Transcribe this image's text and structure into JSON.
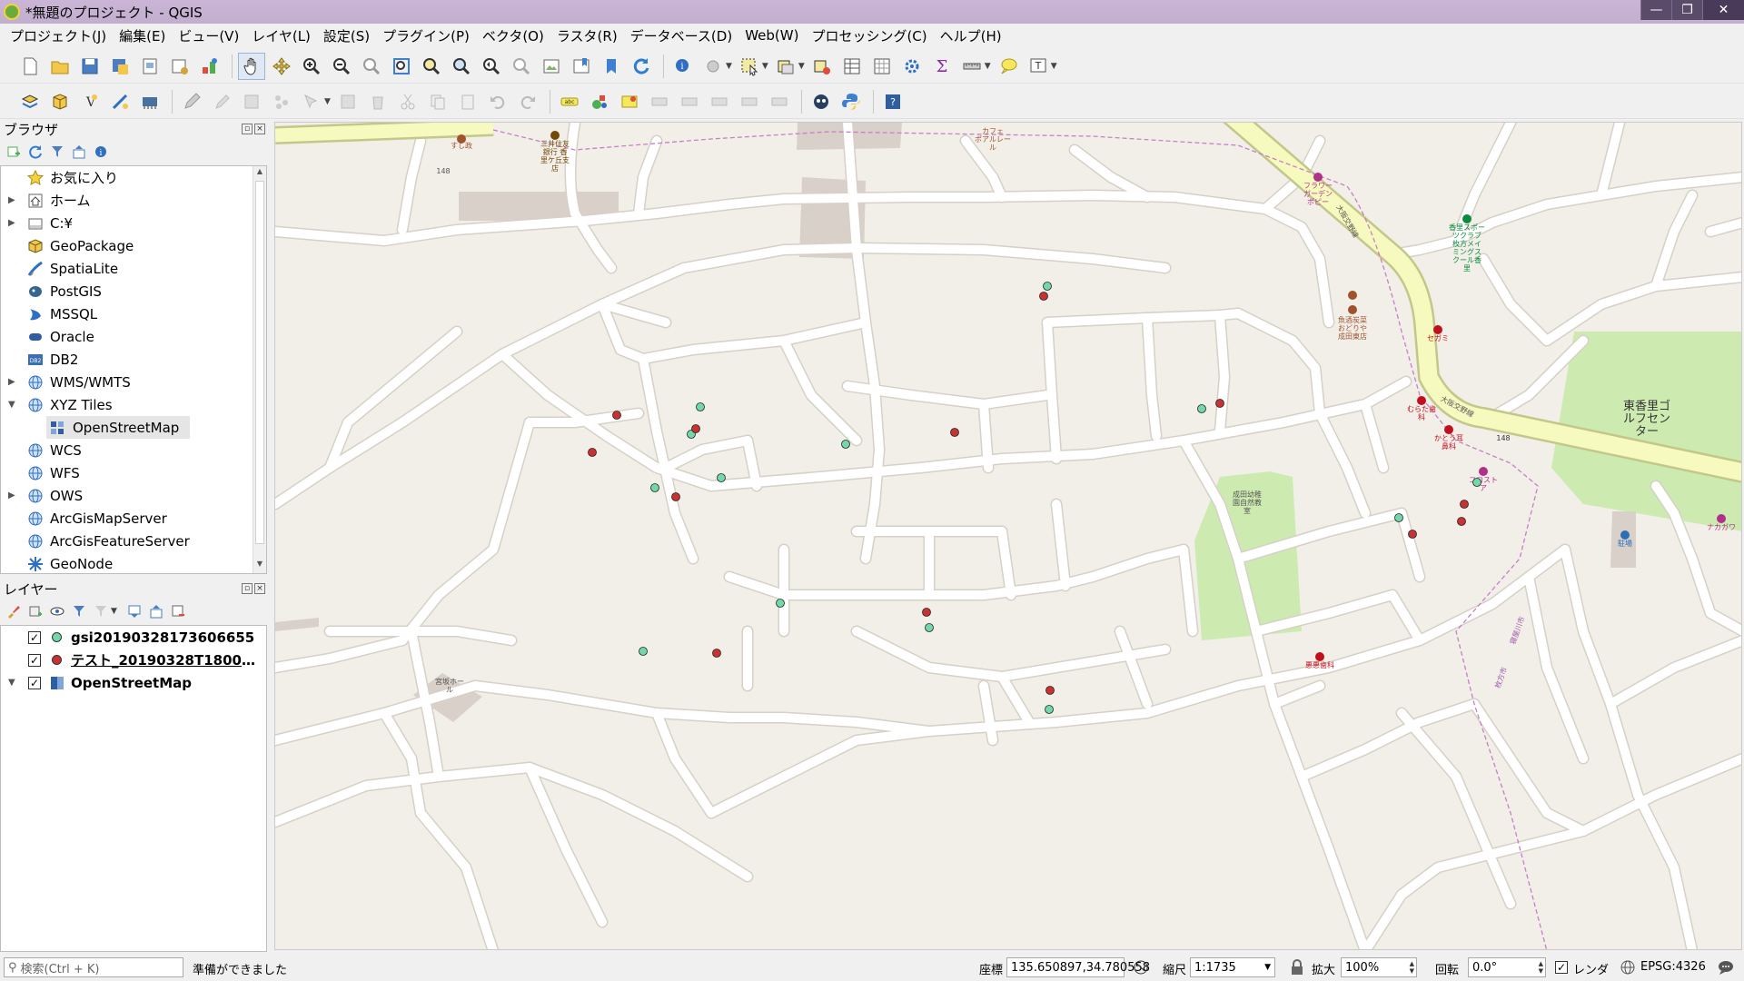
{
  "window": {
    "title": "*無題のプロジェクト - QGIS",
    "buttons": [
      "—",
      "❐",
      "✕"
    ]
  },
  "menu": [
    "プロジェクト(J)",
    "編集(E)",
    "ビュー(V)",
    "レイヤ(L)",
    "設定(S)",
    "プラグイン(P)",
    "ベクタ(O)",
    "ラスタ(R)",
    "データベース(D)",
    "Web(W)",
    "プロセッシング(C)",
    "ヘルプ(H)"
  ],
  "browser": {
    "title": "ブラウザ",
    "items": [
      {
        "label": "お気に入り",
        "icon": "star-icon",
        "expand": ""
      },
      {
        "label": "ホーム",
        "icon": "home-icon",
        "expand": "▶"
      },
      {
        "label": "C:¥",
        "icon": "drive-icon",
        "expand": "▶"
      },
      {
        "label": "GeoPackage",
        "icon": "geopackage-icon",
        "expand": ""
      },
      {
        "label": "SpatiaLite",
        "icon": "spatialite-icon",
        "expand": ""
      },
      {
        "label": "PostGIS",
        "icon": "postgis-icon",
        "expand": ""
      },
      {
        "label": "MSSQL",
        "icon": "mssql-icon",
        "expand": ""
      },
      {
        "label": "Oracle",
        "icon": "oracle-icon",
        "expand": ""
      },
      {
        "label": "DB2",
        "icon": "db2-icon",
        "expand": ""
      },
      {
        "label": "WMS/WMTS",
        "icon": "globe-icon",
        "expand": "▶"
      },
      {
        "label": "XYZ Tiles",
        "icon": "globe-icon",
        "expand": "▼"
      },
      {
        "label": "OpenStreetMap",
        "icon": "xyz-tile-icon",
        "expand": "",
        "child": true,
        "selected": true
      },
      {
        "label": "WCS",
        "icon": "globe-icon",
        "expand": ""
      },
      {
        "label": "WFS",
        "icon": "globe-icon",
        "expand": ""
      },
      {
        "label": "OWS",
        "icon": "globe-icon",
        "expand": "▶"
      },
      {
        "label": "ArcGisMapServer",
        "icon": "globe-icon",
        "expand": ""
      },
      {
        "label": "ArcGisFeatureServer",
        "icon": "globe-icon",
        "expand": ""
      },
      {
        "label": "GeoNode",
        "icon": "geonode-icon",
        "expand": ""
      }
    ]
  },
  "layers": {
    "title": "レイヤー",
    "items": [
      {
        "label": "gsi20190328173606655",
        "color": "#72d8a8",
        "checked": "✓"
      },
      {
        "label": "テスト_20190328T18004…",
        "color": "#c83232",
        "checked": "✓",
        "underline": true
      },
      {
        "label": "OpenStreetMap",
        "color": "",
        "checked": "✓",
        "expand": "▼"
      }
    ]
  },
  "map": {
    "labels": {
      "sushi": "すし政",
      "bank": "三井住友\n銀行 香\n里ケ丘支\n店",
      "route148a": "148",
      "route148b": "148",
      "cafe": "カフェ\nポアルレー\nル",
      "flower": "フラワー\nガーデン\nポピー",
      "road_name1": "大阪交野線",
      "road_name2": "大阪交野線",
      "sports": "香里スポー\nツクラブ\n枚方メイ\nミングス\nクール香\n里",
      "izakaya": "魚酒炭菜\nおどりや\n成田東店",
      "segami": "セガミ",
      "golf": "東香里ゴ\nルフセン\nター",
      "murata": "むらた歯\n科",
      "kato": "かとう耳\n鼻科",
      "kokostore": "ココスト\nア",
      "kindergarten": "成田幼稚\n園自然教\n室",
      "miyanosaka": "宮坂ホー\nル",
      "nakagawa": "ナカガワ",
      "clinic": "悪悪歯科",
      "parking": "駐場",
      "pref": "寝屋川市",
      "pref2": "枚方市"
    },
    "points_green_count": 13,
    "points_red_count": 13
  },
  "status": {
    "search_placeholder": "検索(Ctrl + K)",
    "message": "準備ができました",
    "coord_label": "座標",
    "coord_value": "135.650897,34.780558",
    "scale_label": "縮尺",
    "scale_value": "1:1735",
    "magnify_label": "拡大",
    "magnify_value": "100%",
    "rotation_label": "回転",
    "rotation_value": "0.0°",
    "render_label": "レンダ",
    "render_checked": "✓",
    "crs": "EPSG:4326"
  },
  "colors": {
    "road": "#ffffff",
    "road_outline": "#d6d0c6",
    "primary_road": "#f7fabf",
    "primary_outline": "#c4c78a",
    "land": "#f2efe9",
    "green": "#cdebb0",
    "building": "#d9d0c9",
    "point_green": "#72d8a8",
    "point_red": "#c83232",
    "boundary": "#c77fc9"
  }
}
